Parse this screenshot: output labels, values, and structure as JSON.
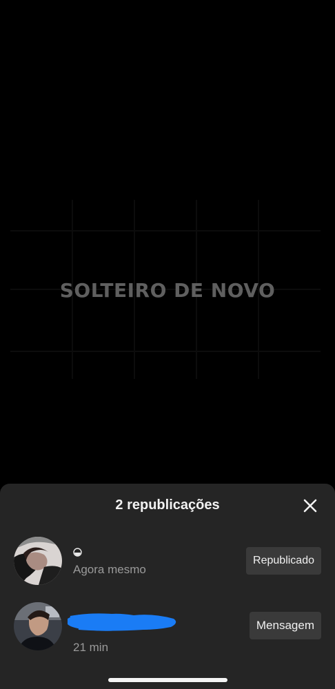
{
  "video": {
    "overlay_text": "SOLTEIRO DE NOVO"
  },
  "sheet": {
    "title": "2 republicações",
    "close_icon": "close-icon",
    "rows": [
      {
        "name": "",
        "name_icon": "moon-icon",
        "subtitle": "Agora mesmo",
        "action_label": "Republicado"
      },
      {
        "name": "",
        "name_redacted": true,
        "subtitle": "21 min",
        "action_label": "Mensagem"
      }
    ]
  },
  "colors": {
    "sheet_background": "#252525",
    "button_background": "#3a3a3a",
    "redaction_blue": "#1a7cf5"
  }
}
